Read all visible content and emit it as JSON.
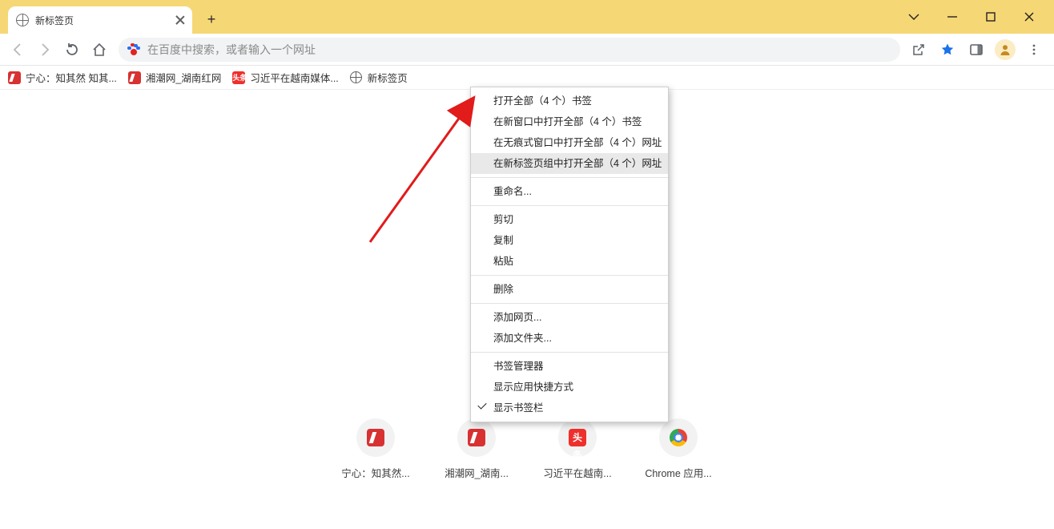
{
  "tab": {
    "title": "新标签页"
  },
  "omnibox": {
    "placeholder": "在百度中搜索，或者输入一个网址"
  },
  "bookmarks": [
    {
      "icon": "red",
      "label": "宁心：知其然 知其..."
    },
    {
      "icon": "red",
      "label": "湘潮网_湖南红网"
    },
    {
      "icon": "tiao",
      "label": "习近平在越南媒体..."
    },
    {
      "icon": "globe",
      "label": "新标签页"
    }
  ],
  "context_menu": {
    "groups": [
      [
        "打开全部（4 个）书签",
        "在新窗口中打开全部（4 个）书签",
        "在无痕式窗口中打开全部（4 个）网址",
        "在新标签页组中打开全部（4 个）网址"
      ],
      [
        "重命名..."
      ],
      [
        "剪切",
        "复制",
        "粘贴"
      ],
      [
        "删除"
      ],
      [
        "添加网页...",
        "添加文件夹..."
      ],
      [
        "书签管理器",
        "显示应用快捷方式",
        "显示书签栏"
      ]
    ],
    "hovered": "在新标签页组中打开全部（4 个）网址",
    "checked": "显示书签栏"
  },
  "tiles": [
    {
      "icon": "red",
      "label": "宁心：知其然..."
    },
    {
      "icon": "red",
      "label": "湘潮网_湖南..."
    },
    {
      "icon": "tiao",
      "label": "习近平在越南..."
    },
    {
      "icon": "chrome",
      "label": "Chrome 应用..."
    }
  ],
  "tiao_text": "头条"
}
